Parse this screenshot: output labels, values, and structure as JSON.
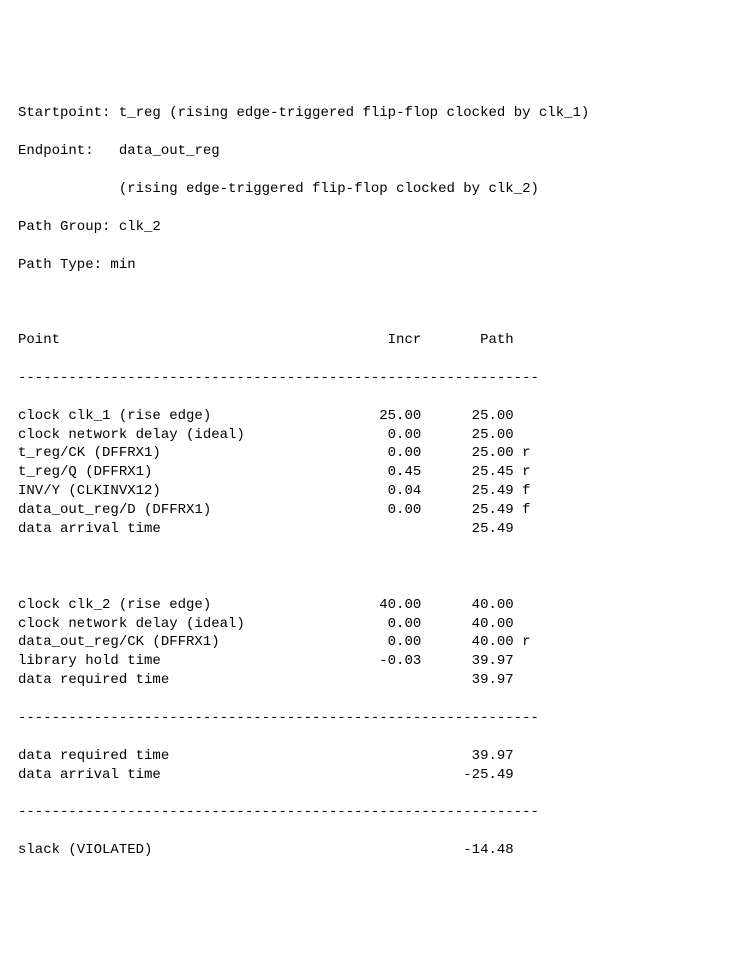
{
  "header": {
    "startpoint_label": "Startpoint:",
    "startpoint_value": "t_reg (rising edge-triggered flip-flop clocked by clk_1)",
    "endpoint_label": "Endpoint:",
    "endpoint_value": "data_out_reg",
    "endpoint_detail_indent": "            ",
    "endpoint_detail": "(rising edge-triggered flip-flop clocked by clk_2)",
    "path_group_label": "Path Group:",
    "path_group_value": "clk_2",
    "path_type_label": "Path Type:",
    "path_type_value": "min"
  },
  "columns": {
    "point": "Point",
    "incr": "Incr",
    "path": "Path"
  },
  "dash_line": "--------------------------------------------------------------",
  "arrival_rows": [
    {
      "point": "clock clk_1 (rise edge)",
      "incr": "25.00",
      "path": "25.00",
      "flag": ""
    },
    {
      "point": "clock network delay (ideal)",
      "incr": "0.00",
      "path": "25.00",
      "flag": ""
    },
    {
      "point": "t_reg/CK (DFFRX1)",
      "incr": "0.00",
      "path": "25.00",
      "flag": "r"
    },
    {
      "point": "t_reg/Q (DFFRX1)",
      "incr": "0.45",
      "path": "25.45",
      "flag": "r"
    },
    {
      "point": "INV/Y (CLKINVX12)",
      "incr": "0.04",
      "path": "25.49",
      "flag": "f"
    },
    {
      "point": "data_out_reg/D (DFFRX1)",
      "incr": "0.00",
      "path": "25.49",
      "flag": "f"
    },
    {
      "point": "data arrival time",
      "incr": "",
      "path": "25.49",
      "flag": ""
    }
  ],
  "required_rows": [
    {
      "point": "clock clk_2 (rise edge)",
      "incr": "40.00",
      "path": "40.00",
      "flag": ""
    },
    {
      "point": "clock network delay (ideal)",
      "incr": "0.00",
      "path": "40.00",
      "flag": ""
    },
    {
      "point": "data_out_reg/CK (DFFRX1)",
      "incr": "0.00",
      "path": "40.00",
      "flag": "r"
    },
    {
      "point": "library hold time",
      "incr": "-0.03",
      "path": "39.97",
      "flag": ""
    },
    {
      "point": "data required time",
      "incr": "",
      "path": "39.97",
      "flag": ""
    }
  ],
  "summary_rows": [
    {
      "point": "data required time",
      "incr": "",
      "path": "39.97",
      "flag": ""
    },
    {
      "point": "data arrival time",
      "incr": "",
      "path": "-25.49",
      "flag": ""
    }
  ],
  "slack_row": {
    "point": "slack (VIOLATED)",
    "incr": "",
    "path": "-14.48",
    "flag": ""
  }
}
